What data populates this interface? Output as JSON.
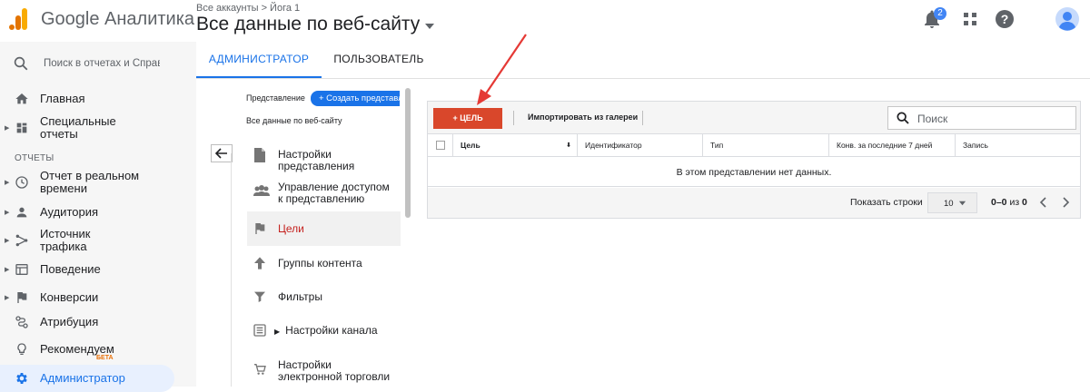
{
  "header": {
    "product": "Google Аналитика",
    "breadcrumb": "Все аккаунты > Йога 1",
    "view_name": "Все данные по веб-сайту",
    "notification_count": "2",
    "icons": [
      "bell-icon",
      "apps-grid-icon",
      "help-icon",
      "account-avatar-icon"
    ],
    "brand_colors": {
      "logo_orange": "#f9ab00",
      "logo_dark": "#e37400"
    }
  },
  "sidebar": {
    "search_label": "Поиск в отчетах и Справке",
    "section_label": "ОТЧЕТЫ",
    "items": [
      {
        "label": "Главная",
        "icon": "home-icon"
      },
      {
        "label": "Специальные отчеты",
        "icon": "custom-reports-icon"
      },
      {
        "label": "Отчет в реальном времени",
        "icon": "realtime-clock-icon"
      },
      {
        "label": "Аудитория",
        "icon": "person-icon"
      },
      {
        "label": "Источник трафика",
        "icon": "acquisition-icon"
      },
      {
        "label": "Поведение",
        "icon": "behavior-icon"
      },
      {
        "label": "Конверсии",
        "icon": "flag-icon"
      },
      {
        "label": "Атрибуция",
        "icon": "attribution-icon"
      },
      {
        "label": "Рекомендуем",
        "icon": "lightbulb-icon"
      },
      {
        "label": "Администратор",
        "icon": "gear-icon"
      }
    ],
    "beta_badge": "БЕТА"
  },
  "tabs": [
    {
      "label": "АДМИНИСТРАТОР",
      "active": true
    },
    {
      "label": "ПОЛЬЗОВАТЕЛЬ",
      "active": false
    }
  ],
  "view_column": {
    "label": "Представление",
    "create_button": "+ Создать представление",
    "view_name": "Все данные по веб-сайту",
    "menu": [
      {
        "label": "Настройки представления",
        "icon": "document-icon"
      },
      {
        "label": "Управление доступом к представлению",
        "icon": "people-icon"
      },
      {
        "label": "Цели",
        "icon": "flag-icon",
        "active": true
      },
      {
        "label": "Группы контента",
        "icon": "content-groups-icon"
      },
      {
        "label": "Фильтры",
        "icon": "filter-icon"
      },
      {
        "label": "Настройки канала",
        "icon": "channel-settings-icon"
      },
      {
        "label": "Настройки электронной торговли",
        "icon": "cart-icon"
      }
    ]
  },
  "goals": {
    "add_button": "+ ЦЕЛЬ",
    "import_button": "Импортировать из галереи",
    "search_placeholder": "Поиск",
    "columns": [
      "Цель",
      "Идентификатор",
      "Тип",
      "Конв. за последние 7 дней",
      "Запись"
    ],
    "empty_message": "В этом представлении нет данных.",
    "footer": {
      "rows_label": "Показать строки",
      "rows_value": "10",
      "range_prefix": "0–0",
      "range_of": " из ",
      "range_total": "0"
    },
    "accent_color": "#d9472b"
  }
}
